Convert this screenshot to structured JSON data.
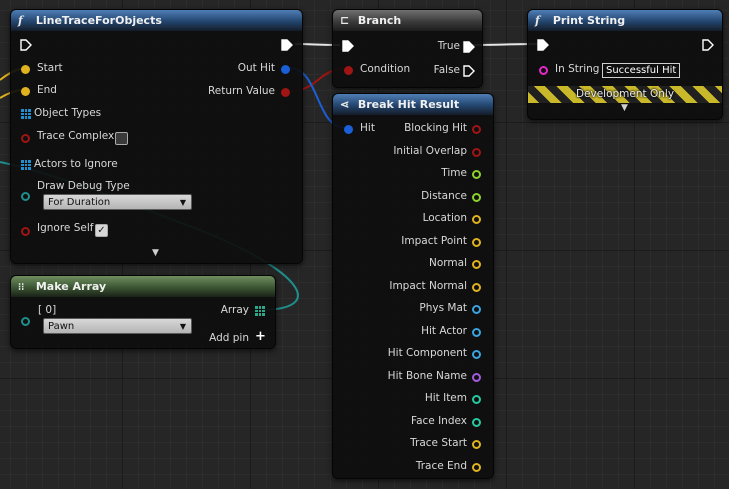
{
  "colors": {
    "exec": "#ffffff",
    "object": "#1a5fd8",
    "bool": "#a01414",
    "float": "#8cd22c",
    "vector": "#e0b21e",
    "physmat": "#3aa3e0",
    "name": "#a35ce0",
    "int": "#26c9a0",
    "string": "#e628c8",
    "array": "#1f8fd0"
  },
  "line_trace": {
    "title": "LineTraceForObjects",
    "icon": "function-icon",
    "start": "Start",
    "end": "End",
    "object_types": "Object Types",
    "trace_complex": "Trace Complex",
    "actors_to_ignore": "Actors to Ignore",
    "draw_debug_type": "Draw Debug Type",
    "draw_debug_value": "For Duration",
    "ignore_self": "Ignore Self",
    "out_hit": "Out Hit",
    "return_value": "Return Value",
    "trace_complex_checked": false,
    "ignore_self_checked": true
  },
  "make_array": {
    "title": "Make Array",
    "index_label": "[ 0]",
    "value": "Pawn",
    "array": "Array",
    "add_pin": "Add pin"
  },
  "branch": {
    "title": "Branch",
    "condition": "Condition",
    "true_label": "True",
    "false_label": "False"
  },
  "break_hit": {
    "title": "Break Hit Result",
    "hit": "Hit",
    "pins": [
      {
        "label": "Blocking Hit",
        "type": "bool"
      },
      {
        "label": "Initial Overlap",
        "type": "bool"
      },
      {
        "label": "Time",
        "type": "float"
      },
      {
        "label": "Distance",
        "type": "float"
      },
      {
        "label": "Location",
        "type": "vector"
      },
      {
        "label": "Impact Point",
        "type": "vector"
      },
      {
        "label": "Normal",
        "type": "vector"
      },
      {
        "label": "Impact Normal",
        "type": "vector"
      },
      {
        "label": "Phys Mat",
        "type": "physmat"
      },
      {
        "label": "Hit Actor",
        "type": "physmat"
      },
      {
        "label": "Hit Component",
        "type": "physmat"
      },
      {
        "label": "Hit Bone Name",
        "type": "name"
      },
      {
        "label": "Hit Item",
        "type": "int"
      },
      {
        "label": "Face Index",
        "type": "int"
      },
      {
        "label": "Trace Start",
        "type": "vector"
      },
      {
        "label": "Trace End",
        "type": "vector"
      }
    ]
  },
  "print_string": {
    "title": "Print String",
    "in_string": "In String",
    "value": "Successful Hit",
    "development_only": "Development Only"
  }
}
